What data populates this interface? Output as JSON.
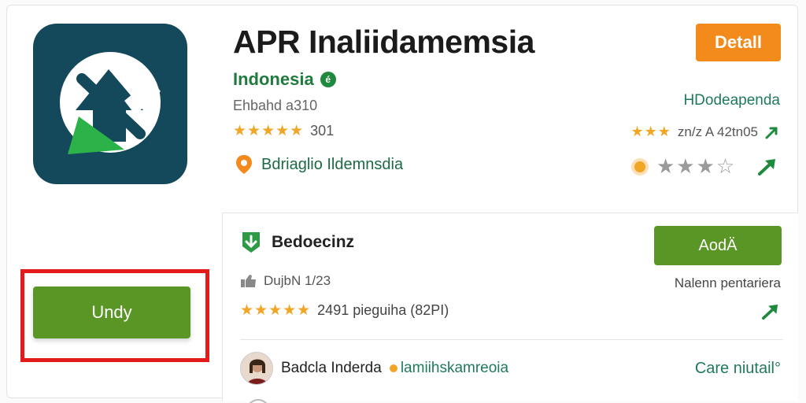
{
  "app": {
    "title": "APR Inaliidamemsia",
    "developer": "Indonesia",
    "verified_badge": "é",
    "subline": "Ehbahd a310",
    "stars": "★★★★★",
    "rating_count": "301",
    "location": "Bdriaglio Ildemnsdia"
  },
  "header_right": {
    "detail_label": "Detall",
    "label": "HDodeapenda",
    "stars": "★★★",
    "rating_text": "zn/z A 42tn05",
    "gray_stars": "★★★☆"
  },
  "card": {
    "title": "Bedoecinz",
    "add_label": "AodÄ",
    "sub_text": "DujbN 1/23",
    "right_label": "Nalenn pentariera",
    "stars": "★★★★★",
    "rating_text": "2491 pieguiha (82PI)",
    "reviewer_name": "Badcla Inderda",
    "reviewer_tag": "lamiihskamreoia",
    "care_link": "Care niutail°"
  },
  "left": {
    "install_label": "Undy"
  },
  "colors": {
    "brand_green": "#5a9625",
    "accent_orange": "#f28a1c",
    "highlight_red": "#e31b1b",
    "icon_bg": "#13495a"
  }
}
